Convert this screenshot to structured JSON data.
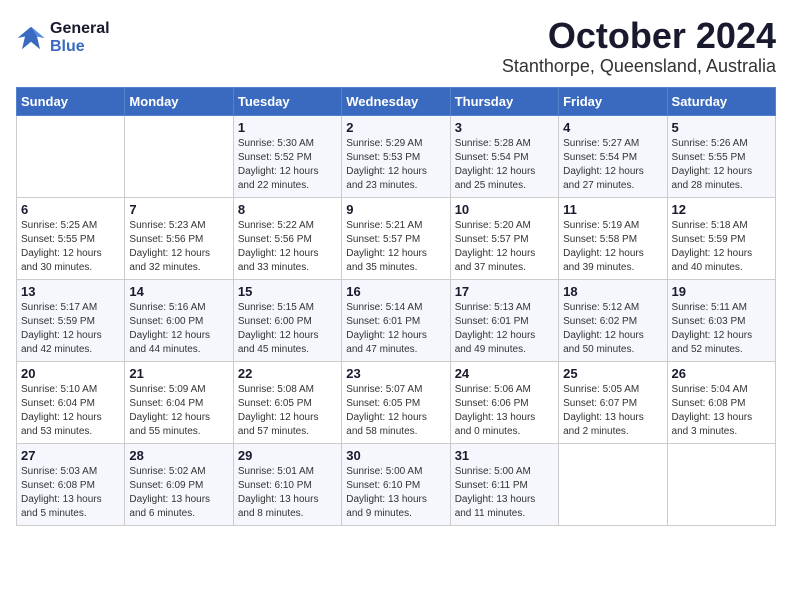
{
  "logo": {
    "text_line1": "General",
    "text_line2": "Blue"
  },
  "title": "October 2024",
  "location": "Stanthorpe, Queensland, Australia",
  "headers": [
    "Sunday",
    "Monday",
    "Tuesday",
    "Wednesday",
    "Thursday",
    "Friday",
    "Saturday"
  ],
  "weeks": [
    [
      {
        "day": "",
        "info": ""
      },
      {
        "day": "",
        "info": ""
      },
      {
        "day": "1",
        "sunrise": "5:30 AM",
        "sunset": "5:52 PM",
        "daylight": "12 hours and 22 minutes."
      },
      {
        "day": "2",
        "sunrise": "5:29 AM",
        "sunset": "5:53 PM",
        "daylight": "12 hours and 23 minutes."
      },
      {
        "day": "3",
        "sunrise": "5:28 AM",
        "sunset": "5:54 PM",
        "daylight": "12 hours and 25 minutes."
      },
      {
        "day": "4",
        "sunrise": "5:27 AM",
        "sunset": "5:54 PM",
        "daylight": "12 hours and 27 minutes."
      },
      {
        "day": "5",
        "sunrise": "5:26 AM",
        "sunset": "5:55 PM",
        "daylight": "12 hours and 28 minutes."
      }
    ],
    [
      {
        "day": "6",
        "sunrise": "5:25 AM",
        "sunset": "5:55 PM",
        "daylight": "12 hours and 30 minutes."
      },
      {
        "day": "7",
        "sunrise": "5:23 AM",
        "sunset": "5:56 PM",
        "daylight": "12 hours and 32 minutes."
      },
      {
        "day": "8",
        "sunrise": "5:22 AM",
        "sunset": "5:56 PM",
        "daylight": "12 hours and 33 minutes."
      },
      {
        "day": "9",
        "sunrise": "5:21 AM",
        "sunset": "5:57 PM",
        "daylight": "12 hours and 35 minutes."
      },
      {
        "day": "10",
        "sunrise": "5:20 AM",
        "sunset": "5:57 PM",
        "daylight": "12 hours and 37 minutes."
      },
      {
        "day": "11",
        "sunrise": "5:19 AM",
        "sunset": "5:58 PM",
        "daylight": "12 hours and 39 minutes."
      },
      {
        "day": "12",
        "sunrise": "5:18 AM",
        "sunset": "5:59 PM",
        "daylight": "12 hours and 40 minutes."
      }
    ],
    [
      {
        "day": "13",
        "sunrise": "5:17 AM",
        "sunset": "5:59 PM",
        "daylight": "12 hours and 42 minutes."
      },
      {
        "day": "14",
        "sunrise": "5:16 AM",
        "sunset": "6:00 PM",
        "daylight": "12 hours and 44 minutes."
      },
      {
        "day": "15",
        "sunrise": "5:15 AM",
        "sunset": "6:00 PM",
        "daylight": "12 hours and 45 minutes."
      },
      {
        "day": "16",
        "sunrise": "5:14 AM",
        "sunset": "6:01 PM",
        "daylight": "12 hours and 47 minutes."
      },
      {
        "day": "17",
        "sunrise": "5:13 AM",
        "sunset": "6:01 PM",
        "daylight": "12 hours and 49 minutes."
      },
      {
        "day": "18",
        "sunrise": "5:12 AM",
        "sunset": "6:02 PM",
        "daylight": "12 hours and 50 minutes."
      },
      {
        "day": "19",
        "sunrise": "5:11 AM",
        "sunset": "6:03 PM",
        "daylight": "12 hours and 52 minutes."
      }
    ],
    [
      {
        "day": "20",
        "sunrise": "5:10 AM",
        "sunset": "6:04 PM",
        "daylight": "12 hours and 53 minutes."
      },
      {
        "day": "21",
        "sunrise": "5:09 AM",
        "sunset": "6:04 PM",
        "daylight": "12 hours and 55 minutes."
      },
      {
        "day": "22",
        "sunrise": "5:08 AM",
        "sunset": "6:05 PM",
        "daylight": "12 hours and 57 minutes."
      },
      {
        "day": "23",
        "sunrise": "5:07 AM",
        "sunset": "6:05 PM",
        "daylight": "12 hours and 58 minutes."
      },
      {
        "day": "24",
        "sunrise": "5:06 AM",
        "sunset": "6:06 PM",
        "daylight": "13 hours and 0 minutes."
      },
      {
        "day": "25",
        "sunrise": "5:05 AM",
        "sunset": "6:07 PM",
        "daylight": "13 hours and 2 minutes."
      },
      {
        "day": "26",
        "sunrise": "5:04 AM",
        "sunset": "6:08 PM",
        "daylight": "13 hours and 3 minutes."
      }
    ],
    [
      {
        "day": "27",
        "sunrise": "5:03 AM",
        "sunset": "6:08 PM",
        "daylight": "13 hours and 5 minutes."
      },
      {
        "day": "28",
        "sunrise": "5:02 AM",
        "sunset": "6:09 PM",
        "daylight": "13 hours and 6 minutes."
      },
      {
        "day": "29",
        "sunrise": "5:01 AM",
        "sunset": "6:10 PM",
        "daylight": "13 hours and 8 minutes."
      },
      {
        "day": "30",
        "sunrise": "5:00 AM",
        "sunset": "6:10 PM",
        "daylight": "13 hours and 9 minutes."
      },
      {
        "day": "31",
        "sunrise": "5:00 AM",
        "sunset": "6:11 PM",
        "daylight": "13 hours and 11 minutes."
      },
      {
        "day": "",
        "info": ""
      },
      {
        "day": "",
        "info": ""
      }
    ]
  ],
  "labels": {
    "sunrise_prefix": "Sunrise: ",
    "sunset_prefix": "Sunset: ",
    "daylight_prefix": "Daylight: "
  }
}
